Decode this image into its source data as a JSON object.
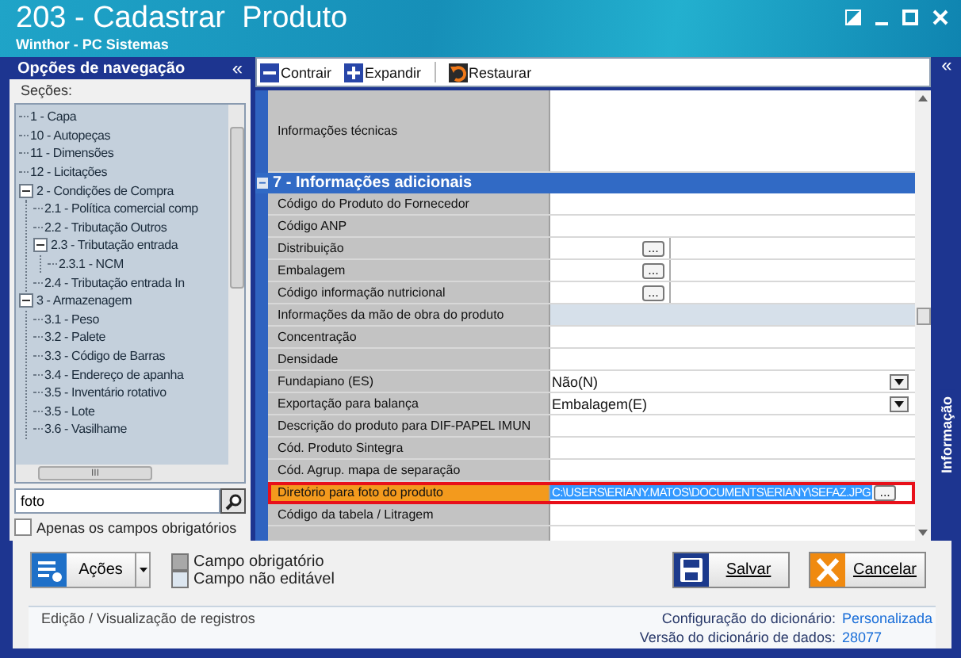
{
  "window": {
    "title": "203 - Cadastrar  Produto",
    "subtitle": "Winthor - PC Sistemas"
  },
  "navigation": {
    "title": "Opções de navegação",
    "collapse": "«",
    "sections_label": "Seções:",
    "tree": [
      {
        "label": "1 - Capa"
      },
      {
        "label": "10 - Autopeças"
      },
      {
        "label": "11 - Dimensões"
      },
      {
        "label": "12 - Licitações"
      },
      {
        "label": "2 - Condições de Compra",
        "expanded": true,
        "children": [
          {
            "label": "2.1 - Política comercial comp"
          },
          {
            "label": "2.2 - Tributação Outros"
          },
          {
            "label": "2.3 - Tributação entrada",
            "expanded": true,
            "children": [
              {
                "label": "2.3.1 - NCM"
              }
            ]
          },
          {
            "label": "2.4 - Tributação entrada In"
          }
        ]
      },
      {
        "label": "3 - Armazenagem",
        "expanded": true,
        "children": [
          {
            "label": "3.1 - Peso"
          },
          {
            "label": "3.2 - Palete"
          },
          {
            "label": "3.3 - Código de Barras"
          },
          {
            "label": "3.4 - Endereço de apanha"
          },
          {
            "label": "3.5 - Inventário rotativo"
          },
          {
            "label": "3.5 - Lote"
          },
          {
            "label": "3.6 - Vasilhame"
          }
        ]
      }
    ],
    "scroll_mark": "III",
    "search": {
      "value": "foto"
    },
    "required_only": {
      "label": "Apenas os campos obrigatórios",
      "checked": false
    }
  },
  "toolbar": [
    {
      "label": "Contrair",
      "kind": "collapse"
    },
    {
      "label": "Expandir",
      "kind": "expand"
    },
    {
      "label": "Restaurar",
      "kind": "restore"
    }
  ],
  "side_tab": {
    "collapse": "«",
    "label": "Informação"
  },
  "grid": {
    "top_row": {
      "label": "Informações técnicas"
    },
    "section": {
      "expander": "−",
      "title": "7 - Informações adicionais"
    },
    "rows": [
      {
        "label": "Código do Produto do Fornecedor",
        "kind": "text",
        "editable": true,
        "selected": false
      },
      {
        "label": "Código ANP",
        "kind": "text",
        "editable": true,
        "selected": false
      },
      {
        "label": "Distribuição",
        "kind": "lookup",
        "button": "...",
        "editable": true,
        "selected": false
      },
      {
        "label": "Embalagem",
        "kind": "lookup",
        "button": "...",
        "editable": true,
        "selected": false
      },
      {
        "label": "Código informação nutricional",
        "kind": "lookup",
        "button": "...",
        "editable": true,
        "selected": false
      },
      {
        "label": "Informações da mão de obra do produto",
        "kind": "text",
        "editable": false,
        "selected": false
      },
      {
        "label": "Concentração",
        "kind": "text",
        "editable": true,
        "selected": false
      },
      {
        "label": "Densidade",
        "kind": "text",
        "editable": true,
        "selected": false
      },
      {
        "label": "Fundapiano (ES)",
        "kind": "dropdown",
        "value": "Não(N)",
        "editable": true,
        "selected": false
      },
      {
        "label": "Exportação para balança",
        "kind": "dropdown",
        "value": "Embalagem(E)",
        "editable": true,
        "selected": false
      },
      {
        "label": "Descrição do produto para DIF-PAPEL IMUN",
        "kind": "text",
        "editable": true,
        "selected": false
      },
      {
        "label": "Cód. Produto Sintegra",
        "kind": "text",
        "editable": true,
        "selected": false
      },
      {
        "label": "Cód. Agrup. mapa de separação",
        "kind": "text",
        "editable": true,
        "selected": false
      },
      {
        "label": "Diretório para foto do produto",
        "kind": "path",
        "value": "C:\\USERS\\ERIANY.MATOS\\DOCUMENTS\\ERIANY\\SEFAZ.JPG",
        "button": "...",
        "editable": true,
        "selected": true
      },
      {
        "label": "Código da tabela / Litragem",
        "kind": "text",
        "editable": true,
        "selected": false
      },
      {
        "kind": "text",
        "editable": true,
        "selected": false
      }
    ]
  },
  "actions": {
    "label": "Ações"
  },
  "legend": [
    {
      "label": "Campo obrigatório",
      "color": "#a8a8a8"
    },
    {
      "label": "Campo não editável",
      "color": "#dce6f0"
    }
  ],
  "buttons": [
    {
      "label": "Salvar",
      "kind": "save"
    },
    {
      "label": "Cancelar",
      "kind": "cancel"
    }
  ],
  "status_bar": {
    "text": "Edição / Visualização de registros",
    "info": [
      {
        "label": "Configuração do dicionário:",
        "value": "Personalizada"
      },
      {
        "label": "Versão do dicionário de dados:",
        "value": "28077"
      }
    ]
  }
}
